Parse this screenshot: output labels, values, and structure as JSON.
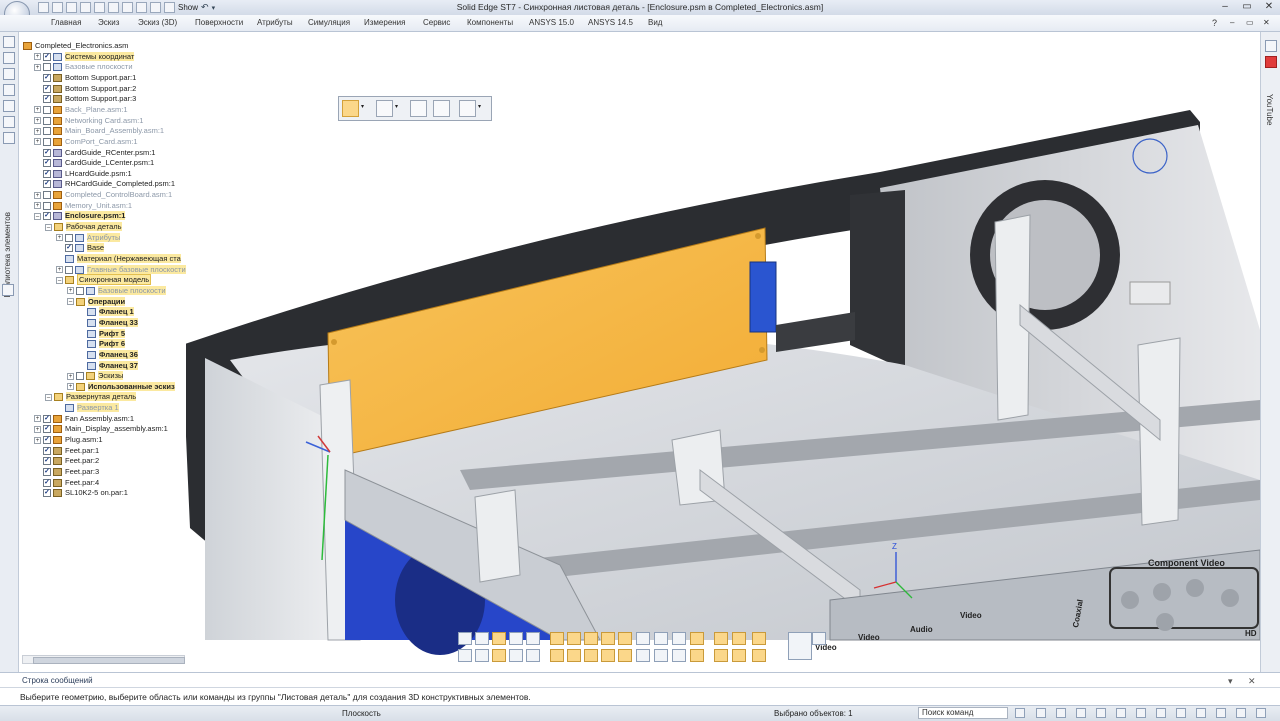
{
  "window": {
    "title": "Solid Edge ST7 - Синхронная листовая деталь - [Enclosure.psm в Completed_Electronics.asm]",
    "qat_show_label": "Show",
    "controls": [
      "–",
      "▭",
      "✕"
    ]
  },
  "ribbon": {
    "tabs": [
      "Главная",
      "Эскиз",
      "Эскиз (3D)",
      "Поверхности",
      "Атрибуты",
      "Симуляция",
      "Измерения",
      "Сервис",
      "Компоненты",
      "ANSYS 15.0",
      "ANSYS 14.5",
      "Вид"
    ]
  },
  "left_strip": {
    "library_label": "Библиотека элементов"
  },
  "right_strip": {
    "youtube_label": "YouTube"
  },
  "tree": {
    "items": [
      {
        "label": "Completed_Electronics.asm",
        "style": "",
        "icon": "asm"
      },
      {
        "label": "Системы координат",
        "style": "hl",
        "icon": "feat"
      },
      {
        "label": "Базовые плоскости",
        "style": "dim",
        "icon": "feat"
      },
      {
        "label": "Bottom Support.par:1",
        "style": "",
        "icon": "par"
      },
      {
        "label": "Bottom Support.par:2",
        "style": "",
        "icon": "par"
      },
      {
        "label": "Bottom Support.par:3",
        "style": "",
        "icon": "par"
      },
      {
        "label": "Back_Plane.asm:1",
        "style": "dim",
        "icon": "asm"
      },
      {
        "label": "Networking Card.asm:1",
        "style": "dim",
        "icon": "asm"
      },
      {
        "label": "Main_Board_Assembly.asm:1",
        "style": "dim",
        "icon": "asm"
      },
      {
        "label": "ComPort_Card.asm:1",
        "style": "dim",
        "icon": "asm"
      },
      {
        "label": "CardGuide_RCenter.psm:1",
        "style": "",
        "icon": "psm"
      },
      {
        "label": "CardGuide_LCenter.psm:1",
        "style": "",
        "icon": "psm"
      },
      {
        "label": "LHcardGuide.psm:1",
        "style": "",
        "icon": "psm"
      },
      {
        "label": "RHCardGuide_Completed.psm:1",
        "style": "",
        "icon": "psm"
      },
      {
        "label": "Completed_ControlBoard.asm:1",
        "style": "dim",
        "icon": "asm"
      },
      {
        "label": "Memory_Unit.asm:1",
        "style": "dim",
        "icon": "asm"
      },
      {
        "label": "Enclosure.psm:1",
        "style": "hlb",
        "icon": "psm"
      },
      {
        "label": "Рабочая деталь",
        "style": "hl",
        "icon": "fold"
      },
      {
        "label": "Атрибуты",
        "style": "hl dim",
        "icon": "feat"
      },
      {
        "label": "Base",
        "style": "hl",
        "icon": "feat"
      },
      {
        "label": "Материал (Нержавеющая ста",
        "style": "hl",
        "icon": "feat"
      },
      {
        "label": "Главные базовые плоскости",
        "style": "hl dim",
        "icon": "feat"
      },
      {
        "label": "Синхронная модель",
        "style": "sel",
        "icon": "fold"
      },
      {
        "label": "Базовые плоскости",
        "style": "hl dim",
        "icon": "feat"
      },
      {
        "label": "Операции",
        "style": "hlb",
        "icon": "fold"
      },
      {
        "label": "Фланец 1",
        "style": "hlb",
        "icon": "feat"
      },
      {
        "label": "Фланец 33",
        "style": "hlb",
        "icon": "feat"
      },
      {
        "label": "Рифт 5",
        "style": "hlb",
        "icon": "feat"
      },
      {
        "label": "Рифт 6",
        "style": "hlb",
        "icon": "feat"
      },
      {
        "label": "Фланец 36",
        "style": "hlb",
        "icon": "feat"
      },
      {
        "label": "Фланец 37",
        "style": "hlb",
        "icon": "feat"
      },
      {
        "label": "Эскизы",
        "style": "hl",
        "icon": "fold"
      },
      {
        "label": "Использованные эскиз",
        "style": "hlb",
        "icon": "fold"
      },
      {
        "label": "Развернутая деталь",
        "style": "hl",
        "icon": "fold"
      },
      {
        "label": "Развертка 1",
        "style": "hl dim",
        "icon": "feat"
      },
      {
        "label": "Fan Assembly.asm:1",
        "style": "",
        "icon": "asm"
      },
      {
        "label": "Main_Display_assembly.asm:1",
        "style": "",
        "icon": "asm"
      },
      {
        "label": "Plug.asm:1",
        "style": "",
        "icon": "asm"
      },
      {
        "label": "Feet.par:1",
        "style": "",
        "icon": "par"
      },
      {
        "label": "Feet.par:2",
        "style": "",
        "icon": "par"
      },
      {
        "label": "Feet.par:3",
        "style": "",
        "icon": "par"
      },
      {
        "label": "Feet.par:4",
        "style": "",
        "icon": "par"
      },
      {
        "label": "SL10K2-5 on.par:1",
        "style": "",
        "icon": "par"
      }
    ]
  },
  "viewport": {
    "panel_labels": [
      "Component Video",
      "Video",
      "Audio",
      "Video",
      "Coaxial",
      "Video",
      "HD"
    ],
    "axis_label": "Z"
  },
  "messages": {
    "title": "Строка сообщений",
    "text": "Выберите геометрию, выберите область или команды из группы \"Листовая деталь\" для создания 3D конструктивных элементов."
  },
  "status": {
    "smooth": "Плоскость",
    "selected": "Выбрано объектов: 1",
    "search": "Поиск команд"
  },
  "colors": {
    "board": "#f6b94a",
    "fan_blue": "#2746c9",
    "metal": "#c9cdd3",
    "dark_shell": "#2b2d31"
  }
}
